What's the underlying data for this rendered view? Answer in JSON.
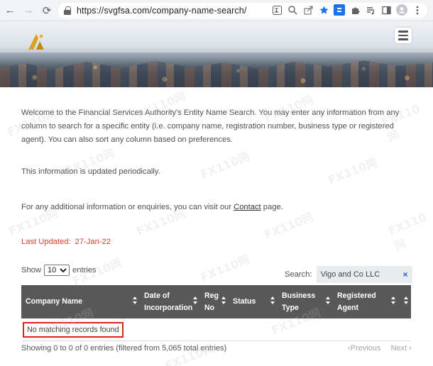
{
  "browser": {
    "url": "https://svgfsa.com/company-name-search/",
    "back_icon": "←",
    "forward_icon": "→",
    "reload_icon": "⟳"
  },
  "site": {
    "brand_color": "#d9a21b"
  },
  "content": {
    "intro": "Welcome to the Financial Services Authority's Entity Name Search. You may enter any information from any column to search for a specific entity (i.e. company name, registration number, business type or registered agent). You can also sort any column based on preferences.",
    "updated_note": "This information is updated periodically.",
    "contact_prefix": "For any additional information or enquiries, you can visit our ",
    "contact_link": "Contact",
    "contact_suffix": " page.",
    "last_updated_label": "Last Updated:",
    "last_updated_value": "27-Jan-22"
  },
  "controls": {
    "show_label": "Show",
    "entries_label": "entries",
    "page_size": "10",
    "search_label": "Search:",
    "search_value": "Vigo and Co LLC",
    "clear_icon": "×"
  },
  "table": {
    "columns": [
      {
        "label_line1": "Company Name",
        "label_line2": ""
      },
      {
        "label_line1": "Date of",
        "label_line2": "Incorporation"
      },
      {
        "label_line1": "Reg",
        "label_line2": "No"
      },
      {
        "label_line1": "Status",
        "label_line2": ""
      },
      {
        "label_line1": "Business",
        "label_line2": "Type"
      },
      {
        "label_line1": "Registered",
        "label_line2": "Agent"
      }
    ],
    "empty_message": "No matching records found",
    "header_color": "#585858",
    "highlight_color": "#d9291c"
  },
  "footer": {
    "info": "Showing 0 to 0 of 0 entries (filtered from 5,065 total entries)",
    "previous_label": "‹Previous",
    "next_label": "Next ›"
  },
  "watermark": "FX110网"
}
